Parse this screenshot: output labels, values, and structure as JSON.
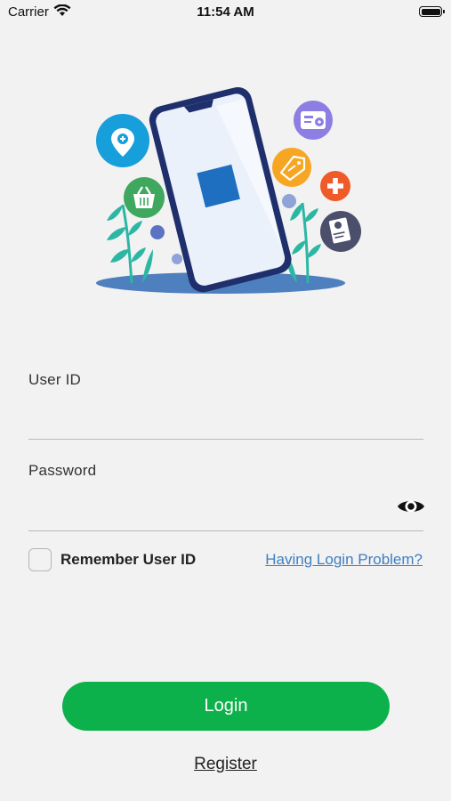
{
  "status_bar": {
    "carrier": "Carrier",
    "time": "11:54 AM"
  },
  "login_form": {
    "user_id_label": "User ID",
    "user_id_value": "",
    "password_label": "Password",
    "password_value": "",
    "remember_label": "Remember User ID",
    "remember_checked": false,
    "login_problem_link": "Having Login Problem?",
    "login_button": "Login",
    "register_link": "Register"
  },
  "colors": {
    "background": "#f2f2f2",
    "primary_green": "#0db14b",
    "link_blue": "#3d7fc2",
    "phone_outline": "#1f2f6b",
    "logo_blue": "#1e6fc0"
  },
  "illustration": {
    "icons": [
      "location-pin-icon",
      "shopping-basket-icon",
      "id-card-icon",
      "price-tag-icon",
      "medical-cross-icon",
      "receipt-icon"
    ]
  }
}
